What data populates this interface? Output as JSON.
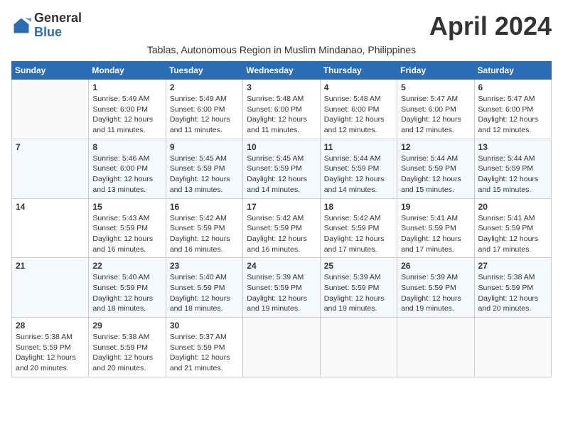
{
  "logo": {
    "line1": "General",
    "line2": "Blue"
  },
  "title": "April 2024",
  "subtitle": "Tablas, Autonomous Region in Muslim Mindanao, Philippines",
  "days_header": [
    "Sunday",
    "Monday",
    "Tuesday",
    "Wednesday",
    "Thursday",
    "Friday",
    "Saturday"
  ],
  "weeks": [
    [
      {
        "day": "",
        "info": ""
      },
      {
        "day": "1",
        "info": "Sunrise: 5:49 AM\nSunset: 6:00 PM\nDaylight: 12 hours\nand 11 minutes."
      },
      {
        "day": "2",
        "info": "Sunrise: 5:49 AM\nSunset: 6:00 PM\nDaylight: 12 hours\nand 11 minutes."
      },
      {
        "day": "3",
        "info": "Sunrise: 5:48 AM\nSunset: 6:00 PM\nDaylight: 12 hours\nand 11 minutes."
      },
      {
        "day": "4",
        "info": "Sunrise: 5:48 AM\nSunset: 6:00 PM\nDaylight: 12 hours\nand 12 minutes."
      },
      {
        "day": "5",
        "info": "Sunrise: 5:47 AM\nSunset: 6:00 PM\nDaylight: 12 hours\nand 12 minutes."
      },
      {
        "day": "6",
        "info": "Sunrise: 5:47 AM\nSunset: 6:00 PM\nDaylight: 12 hours\nand 12 minutes."
      }
    ],
    [
      {
        "day": "7",
        "info": ""
      },
      {
        "day": "8",
        "info": "Sunrise: 5:46 AM\nSunset: 6:00 PM\nDaylight: 12 hours\nand 13 minutes."
      },
      {
        "day": "9",
        "info": "Sunrise: 5:45 AM\nSunset: 5:59 PM\nDaylight: 12 hours\nand 13 minutes."
      },
      {
        "day": "10",
        "info": "Sunrise: 5:45 AM\nSunset: 5:59 PM\nDaylight: 12 hours\nand 14 minutes."
      },
      {
        "day": "11",
        "info": "Sunrise: 5:44 AM\nSunset: 5:59 PM\nDaylight: 12 hours\nand 14 minutes."
      },
      {
        "day": "12",
        "info": "Sunrise: 5:44 AM\nSunset: 5:59 PM\nDaylight: 12 hours\nand 15 minutes."
      },
      {
        "day": "13",
        "info": "Sunrise: 5:44 AM\nSunset: 5:59 PM\nDaylight: 12 hours\nand 15 minutes."
      }
    ],
    [
      {
        "day": "14",
        "info": ""
      },
      {
        "day": "15",
        "info": "Sunrise: 5:43 AM\nSunset: 5:59 PM\nDaylight: 12 hours\nand 16 minutes."
      },
      {
        "day": "16",
        "info": "Sunrise: 5:42 AM\nSunset: 5:59 PM\nDaylight: 12 hours\nand 16 minutes."
      },
      {
        "day": "17",
        "info": "Sunrise: 5:42 AM\nSunset: 5:59 PM\nDaylight: 12 hours\nand 16 minutes."
      },
      {
        "day": "18",
        "info": "Sunrise: 5:42 AM\nSunset: 5:59 PM\nDaylight: 12 hours\nand 17 minutes."
      },
      {
        "day": "19",
        "info": "Sunrise: 5:41 AM\nSunset: 5:59 PM\nDaylight: 12 hours\nand 17 minutes."
      },
      {
        "day": "20",
        "info": "Sunrise: 5:41 AM\nSunset: 5:59 PM\nDaylight: 12 hours\nand 17 minutes."
      }
    ],
    [
      {
        "day": "21",
        "info": ""
      },
      {
        "day": "22",
        "info": "Sunrise: 5:40 AM\nSunset: 5:59 PM\nDaylight: 12 hours\nand 18 minutes."
      },
      {
        "day": "23",
        "info": "Sunrise: 5:40 AM\nSunset: 5:59 PM\nDaylight: 12 hours\nand 18 minutes."
      },
      {
        "day": "24",
        "info": "Sunrise: 5:39 AM\nSunset: 5:59 PM\nDaylight: 12 hours\nand 19 minutes."
      },
      {
        "day": "25",
        "info": "Sunrise: 5:39 AM\nSunset: 5:59 PM\nDaylight: 12 hours\nand 19 minutes."
      },
      {
        "day": "26",
        "info": "Sunrise: 5:39 AM\nSunset: 5:59 PM\nDaylight: 12 hours\nand 19 minutes."
      },
      {
        "day": "27",
        "info": "Sunrise: 5:38 AM\nSunset: 5:59 PM\nDaylight: 12 hours\nand 20 minutes."
      }
    ],
    [
      {
        "day": "28",
        "info": "Sunrise: 5:38 AM\nSunset: 5:59 PM\nDaylight: 12 hours\nand 20 minutes."
      },
      {
        "day": "29",
        "info": "Sunrise: 5:38 AM\nSunset: 5:59 PM\nDaylight: 12 hours\nand 20 minutes."
      },
      {
        "day": "30",
        "info": "Sunrise: 5:37 AM\nSunset: 5:59 PM\nDaylight: 12 hours\nand 21 minutes."
      },
      {
        "day": "",
        "info": ""
      },
      {
        "day": "",
        "info": ""
      },
      {
        "day": "",
        "info": ""
      },
      {
        "day": "",
        "info": ""
      }
    ]
  ]
}
